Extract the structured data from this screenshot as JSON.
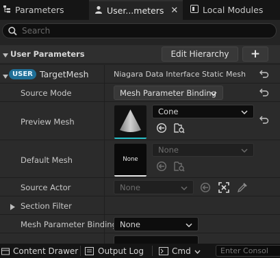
{
  "tabs": [
    {
      "label": "Parameters",
      "icon": "hierarchy-icon"
    },
    {
      "label": "User...meters",
      "icon": "person-icon",
      "active": true
    },
    {
      "label": "Local Modules",
      "icon": "module-icon"
    }
  ],
  "search": {
    "placeholder": "Search",
    "value": ""
  },
  "section": {
    "title": "User Parameters",
    "edit_button": "Edit Hierarchy",
    "add_button": "+"
  },
  "parameter": {
    "badge": "USER",
    "name": "TargetMesh",
    "type": "Niagara Data Interface Static Mesh"
  },
  "rows": {
    "source_mode": {
      "label": "Source Mode",
      "value": "Mesh Parameter Binding"
    },
    "preview_mesh": {
      "label": "Preview Mesh",
      "value": "Cone"
    },
    "default_mesh": {
      "label": "Default Mesh",
      "value": "None",
      "thumb_text": "None"
    },
    "source_actor": {
      "label": "Source Actor",
      "value": "None"
    },
    "section_filter": {
      "label": "Section Filter"
    },
    "mesh_parameter_binding": {
      "label": "Mesh Parameter Binding",
      "value": "None"
    }
  },
  "statusbar": {
    "content_drawer": "Content Drawer",
    "output_log": "Output Log",
    "cmd": "Cmd",
    "console_placeholder": "Enter Consol"
  },
  "colors": {
    "accent": "#26bbff",
    "badge": "#1f6f97",
    "background": "#242424"
  }
}
